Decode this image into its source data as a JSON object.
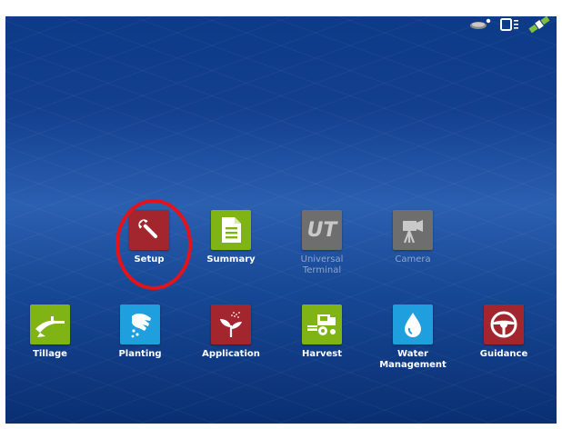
{
  "status_bar": {
    "icons": [
      "gps-receiver-icon",
      "display-device-icon",
      "satellite-icon"
    ]
  },
  "colors": {
    "setup_red": "#a3262e",
    "app_green": "#7fb414",
    "disabled_gray": "#6e6e6e",
    "app_blue": "#1f9fdd",
    "highlight_red": "#e4121b"
  },
  "apps": {
    "setup": {
      "label": "Setup",
      "icon": "wrench-icon"
    },
    "summary": {
      "label": "Summary",
      "icon": "document-icon"
    },
    "universal_terminal": {
      "label": "Universal\nTerminal",
      "icon": "ut-icon",
      "mark": "UT"
    },
    "camera": {
      "label": "Camera",
      "icon": "camera-icon"
    },
    "tillage": {
      "label": "Tillage",
      "icon": "plow-icon"
    },
    "planting": {
      "label": "Planting",
      "icon": "hand-seed-icon"
    },
    "application": {
      "label": "Application",
      "icon": "sprout-spray-icon"
    },
    "harvest": {
      "label": "Harvest",
      "icon": "combine-icon"
    },
    "water_management": {
      "label": "Water\nManagement",
      "icon": "water-drop-icon"
    },
    "guidance": {
      "label": "Guidance",
      "icon": "steering-wheel-icon"
    }
  }
}
